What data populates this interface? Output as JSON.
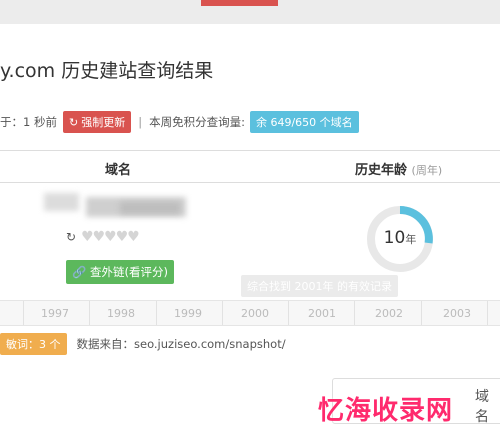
{
  "page": {
    "title": "y.com 历史建站查询结果"
  },
  "info_bar": {
    "time_text": "于：1 秒前",
    "force_update": "强制更新",
    "separator": "|",
    "quota_label": "本周免积分查询量:",
    "quota_badge": "余 649/650 个域名"
  },
  "table": {
    "col_domain": "域名",
    "col_age": "历史年龄",
    "col_age_unit": "(周年)"
  },
  "row": {
    "hearts": "♥♥♥♥♥",
    "outbound_button": "查外链(看评分)",
    "age_value": "10",
    "age_unit": "年",
    "tooltip": "综合找到 2001年 的有效记录"
  },
  "timeline": {
    "years": [
      "1997",
      "1998",
      "1999",
      "2000",
      "2001",
      "2002",
      "2003"
    ]
  },
  "bottom": {
    "badge": "敏词：3 个",
    "source_label": "数据来自：seo.juziseo.com/snapshot/"
  },
  "overlay": {
    "text": "域名"
  },
  "watermark": {
    "text": "忆海收录网"
  },
  "colors": {
    "red": "#d9534f",
    "blue": "#5bc0de",
    "green": "#5cb85c",
    "orange": "#f0ad4e",
    "gauge": "#5bc0de",
    "watermark": "#ff2a6d"
  }
}
